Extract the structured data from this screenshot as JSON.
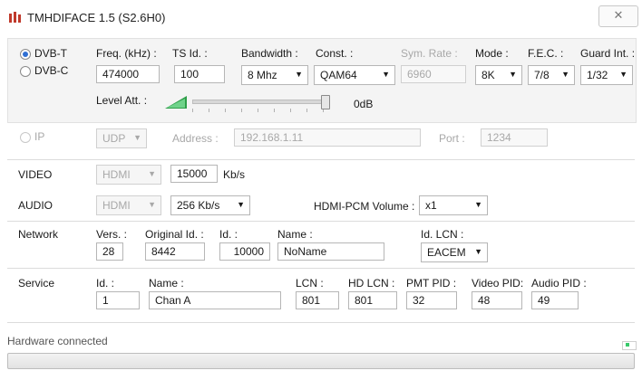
{
  "window": {
    "title": "TMHDIFACE 1.5 (S2.6H0)",
    "close_glyph": "✕",
    "icon": "app-bar-icon"
  },
  "dvb": {
    "radios": [
      {
        "label": "DVB-T",
        "selected": true
      },
      {
        "label": "DVB-C",
        "selected": false
      }
    ],
    "freq_label": "Freq. (kHz) :",
    "freq_value": "474000",
    "tsid_label": "TS Id. :",
    "tsid_value": "100",
    "bandwidth_label": "Bandwidth :",
    "bandwidth_value": "8 Mhz",
    "const_label": "Const. :",
    "const_value": "QAM64",
    "symrate_label": "Sym. Rate :",
    "symrate_value": "6960",
    "mode_label": "Mode :",
    "mode_value": "8K",
    "fec_label": "F.E.C. :",
    "fec_value": "7/8",
    "guard_label": "Guard Int. :",
    "guard_value": "1/32",
    "level_label": "Level Att. :",
    "level_value": "0dB",
    "level_fraction": 1.0
  },
  "ip": {
    "radio_label": "IP",
    "protocol_value": "UDP",
    "address_label": "Address :",
    "address_value": "192.168.1.11",
    "port_label": "Port :",
    "port_value": "1234"
  },
  "video": {
    "label": "VIDEO",
    "source_value": "HDMI",
    "bitrate_value": "15000",
    "unit": "Kb/s"
  },
  "audio": {
    "label": "AUDIO",
    "source_value": "HDMI",
    "bitrate_value": "256 Kb/s",
    "pcm_label": "HDMI-PCM Volume :",
    "pcm_value": "x1"
  },
  "network": {
    "label": "Network",
    "vers_label": "Vers. :",
    "vers_value": "28",
    "orig_label": "Original Id. :",
    "orig_value": "8442",
    "id_label": "Id. :",
    "id_value": "10000",
    "name_label": "Name :",
    "name_value": "NoName",
    "lcn_label": "Id. LCN :",
    "lcn_value": "EACEM"
  },
  "service": {
    "label": "Service",
    "id_label": "Id. :",
    "id_value": "1",
    "name_label": "Name :",
    "name_value": "Chan A",
    "lcn_label": "LCN :",
    "lcn_value": "801",
    "hdlcn_label": "HD LCN :",
    "hdlcn_value": "801",
    "pmt_label": "PMT PID :",
    "pmt_value": "32",
    "video_label": "Video PID:",
    "video_value": "48",
    "audio_label": "Audio PID :",
    "audio_value": "49"
  },
  "status": {
    "text": "Hardware connected",
    "led_color": "#39c96b",
    "progress_fraction": 0
  }
}
